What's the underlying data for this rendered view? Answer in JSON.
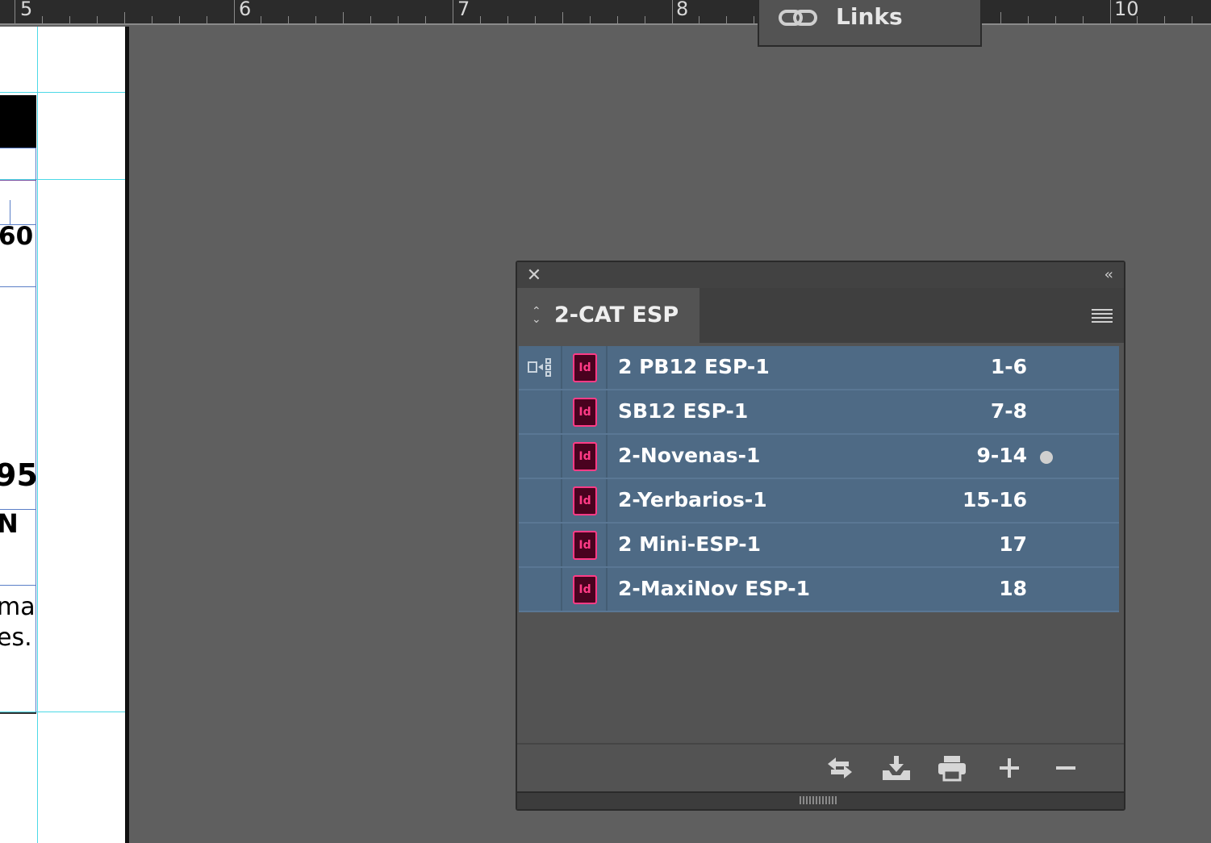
{
  "ruler": {
    "numbers": [
      "5",
      "6",
      "7",
      "8",
      "10"
    ]
  },
  "links_panel": {
    "label": "Links",
    "icon": "link-icon"
  },
  "document": {
    "fragments": [
      "60",
      "95",
      "N",
      "ma",
      "es."
    ]
  },
  "book_panel": {
    "tab_label": "2-CAT ESP",
    "icons": {
      "close": "close-icon",
      "collapse": "collapse-icon",
      "menu": "panel-menu-icon",
      "sync_source": "style-source-icon",
      "document": "indesign-document-icon"
    },
    "doc_icon_text": "Id",
    "documents": [
      {
        "name": "2 PB12 ESP-1",
        "pages": "1-6"
      },
      {
        "name": "SB12 ESP-1",
        "pages": "7-8"
      },
      {
        "name": "2-Novenas-1",
        "pages": "9-14"
      },
      {
        "name": "2-Yerbarios-1",
        "pages": "15-16"
      },
      {
        "name": "2 Mini-ESP-1",
        "pages": "17"
      },
      {
        "name": "2-MaxiNov ESP-1",
        "pages": "18"
      }
    ],
    "footer_buttons": [
      "synchronize-icon",
      "save-book-icon",
      "print-book-icon",
      "add-document-icon",
      "remove-document-icon"
    ]
  },
  "colors": {
    "row_selected": "#4e6a85",
    "indesign_accent": "#ff3b86",
    "panel_bg": "#535353"
  }
}
